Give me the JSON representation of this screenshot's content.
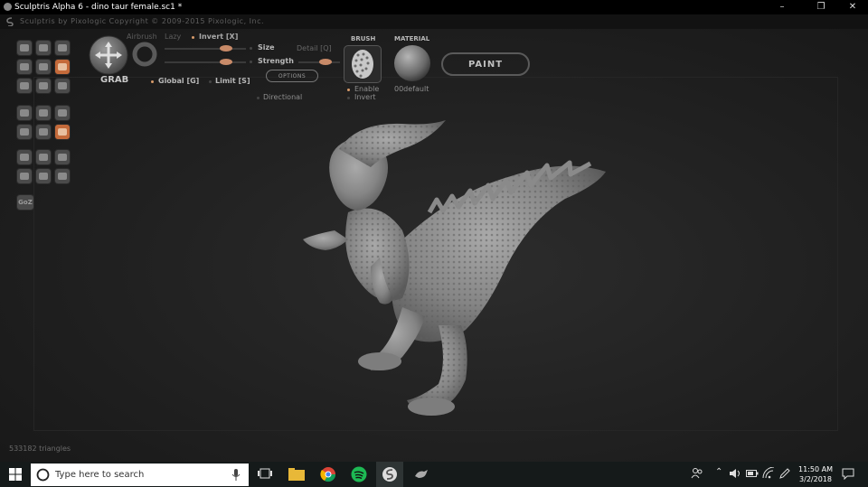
{
  "window": {
    "title": "Sculptris Alpha 6 - dino taur female.sc1 *",
    "subtitle": "Sculptris by Pixologic    Copyright © 2009-2015 Pixologic, Inc.",
    "min_glyph": "–",
    "restore_glyph": "❐",
    "close_glyph": "✕"
  },
  "toolbar": {
    "tool_name": "GRAB",
    "airbrush_label": "Airbrush",
    "lazy_label": "Lazy",
    "invert_label": "Invert [X]",
    "size_label": "Size",
    "strength_label": "Strength",
    "detail_label": "Detail [Q]",
    "options_label": "OPTIONS",
    "global_label": "Global [G]",
    "limit_label": "Limit [S]",
    "directional_label": "Directional",
    "brush_label": "BRUSH",
    "material_label": "MATERIAL",
    "enable_label": "Enable",
    "brush_invert_label": "Invert",
    "material_name": "00default",
    "paint_label": "PAINT",
    "goz_label": "GoZ",
    "size_value": 0.85,
    "strength_value": 0.85,
    "detail_value": 0.65
  },
  "status": {
    "triangles": "533182 triangles"
  },
  "taskbar": {
    "search_placeholder": "Type here to search",
    "time": "11:50 AM",
    "date": "3/2/2018"
  },
  "colors": {
    "accent": "#c46a3a",
    "background": "#1f1f1f",
    "model": "#8e8e8e"
  }
}
